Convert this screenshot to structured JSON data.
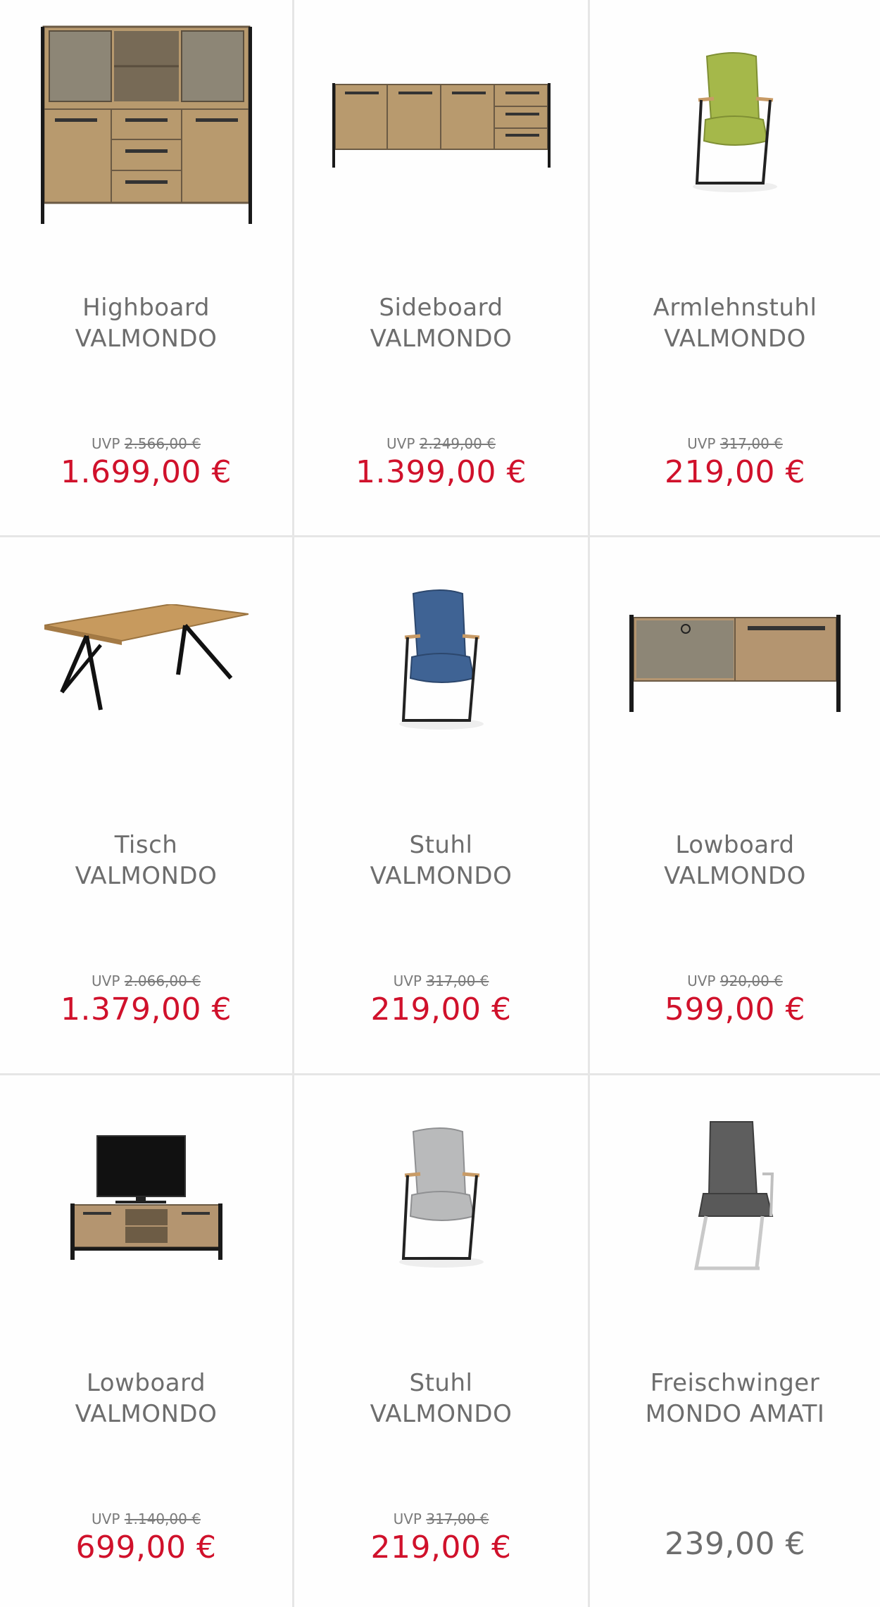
{
  "products": [
    {
      "name": "Highboard",
      "brand": "VALMONDO",
      "uvp_label": "UVP",
      "uvp_price": "2.566,00 €",
      "price": "1.699,00 €",
      "image": "highboard-image"
    },
    {
      "name": "Sideboard",
      "brand": "VALMONDO",
      "uvp_label": "UVP",
      "uvp_price": "2.249,00 €",
      "price": "1.399,00 €",
      "image": "sideboard-image"
    },
    {
      "name": "Armlehnstuhl",
      "brand": "VALMONDO",
      "uvp_label": "UVP",
      "uvp_price": "317,00 €",
      "price": "219,00 €",
      "image": "armchair-green-image"
    },
    {
      "name": "Tisch",
      "brand": "VALMONDO",
      "uvp_label": "UVP",
      "uvp_price": "2.066,00 €",
      "price": "1.379,00 €",
      "image": "table-image"
    },
    {
      "name": "Stuhl",
      "brand": "VALMONDO",
      "uvp_label": "UVP",
      "uvp_price": "317,00 €",
      "price": "219,00 €",
      "image": "chair-blue-image"
    },
    {
      "name": "Lowboard",
      "brand": "VALMONDO",
      "uvp_label": "UVP",
      "uvp_price": "920,00 €",
      "price": "599,00 €",
      "image": "lowboard-image"
    },
    {
      "name": "Lowboard",
      "brand": "VALMONDO",
      "uvp_label": "UVP",
      "uvp_price": "1.140,00 €",
      "price": "699,00 €",
      "image": "tv-lowboard-image"
    },
    {
      "name": "Stuhl",
      "brand": "VALMONDO",
      "uvp_label": "UVP",
      "uvp_price": "317,00 €",
      "price": "219,00 €",
      "image": "chair-grey-image"
    },
    {
      "name": "Freischwinger",
      "brand": "MONDO AMATI",
      "uvp_label": "",
      "uvp_price": "",
      "price": "239,00 €",
      "image": "cantilever-chair-image"
    }
  ],
  "colors": {
    "price_red": "#d0112b",
    "text_grey": "#6d6d6d",
    "divider": "#e6e6e6",
    "wood": "#b89a6e",
    "metal": "#1a1a1a"
  }
}
